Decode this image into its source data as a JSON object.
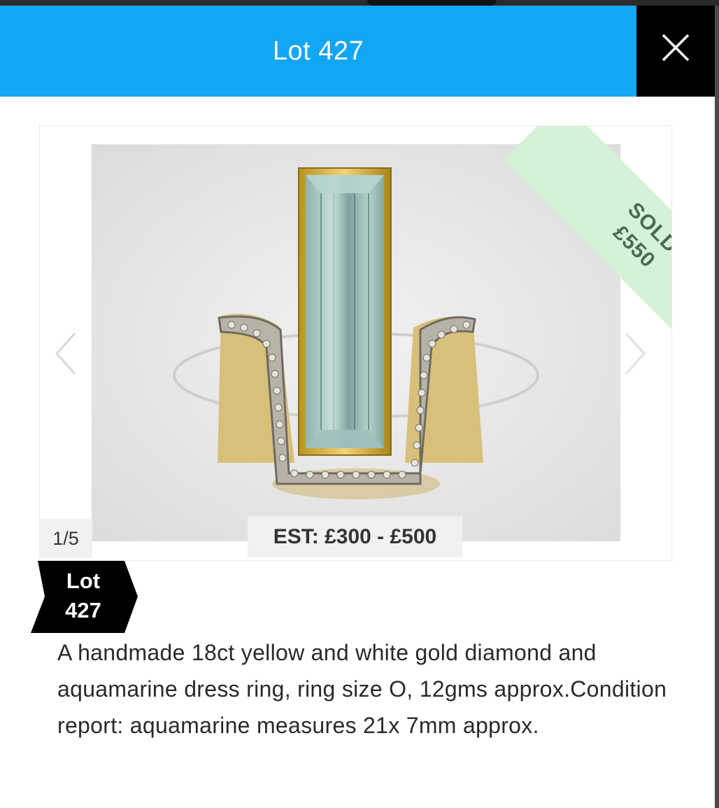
{
  "modal": {
    "title": "Lot 427",
    "close_icon": "close-icon"
  },
  "gallery": {
    "counter": "1/5",
    "estimate": "EST: £300 - £500",
    "sold_status": "SOLD",
    "sold_price": "£550",
    "prev_icon": "chevron-left-icon",
    "next_icon": "chevron-right-icon",
    "image_subject": "aquamarine and diamond dress ring"
  },
  "lot_tag": {
    "line1": "Lot",
    "line2": "427"
  },
  "description": "A handmade 18ct yellow and white gold diamond and aquamarine dress ring, ring size O, 12gms approx.Condition report: aquamarine measures 21x 7mm approx.",
  "colors": {
    "header": "#13a6f2",
    "close_bg": "#000000",
    "sold_ribbon": "#d6f2d6",
    "sold_text": "#4d6a50"
  }
}
